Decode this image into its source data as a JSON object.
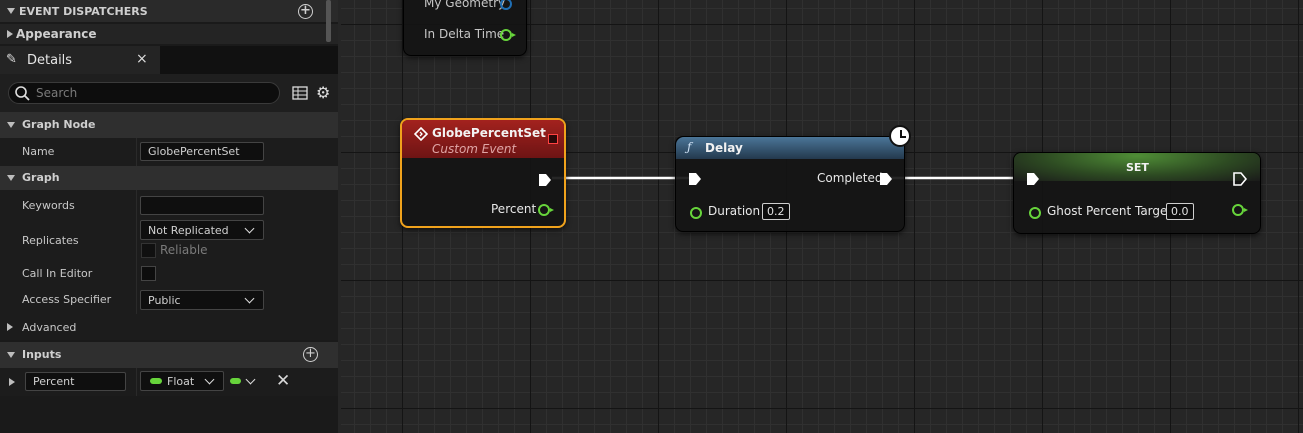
{
  "left_panel": {
    "event_dispatchers_label": "EVENT DISPATCHERS",
    "appearance_label": "Appearance",
    "details_tab": {
      "label": "Details",
      "close": "×"
    },
    "search": {
      "placeholder": "Search"
    },
    "graph_node_section": "Graph Node",
    "name_label": "Name",
    "name_value": "GlobePercentSet",
    "graph_section": "Graph",
    "keywords_label": "Keywords",
    "keywords_value": "",
    "replicates_label": "Replicates",
    "replicates_value": "Not Replicated",
    "reliable_label": "Reliable",
    "call_in_editor_label": "Call In Editor",
    "access_specifier_label": "Access Specifier",
    "access_specifier_value": "Public",
    "advanced_label": "Advanced",
    "inputs_section": "Inputs",
    "input_param": {
      "name": "Percent",
      "type": "Float"
    },
    "colors": {
      "float_pin": "#67d43b",
      "exec": "#ffffff"
    }
  },
  "graph": {
    "tick_node": {
      "pin1": "My Geometry",
      "pin2": "In Delta Time"
    },
    "custom_event_node": {
      "title": "GlobePercentSet",
      "subtitle": "Custom Event",
      "output_pin": "Percent",
      "header_color": "#8c1a1a",
      "selected_outline": "#f0a21c"
    },
    "delay_node": {
      "title": "Delay",
      "func_glyph": "ƒ",
      "completed_label": "Completed",
      "duration_label": "Duration",
      "duration_value": "0.2",
      "header_color": "#3a5c7a"
    },
    "set_node": {
      "title": "SET",
      "pin_label": "Ghost Percent Target",
      "pin_value": "0.0",
      "header_color": "#3b6b2a"
    }
  }
}
